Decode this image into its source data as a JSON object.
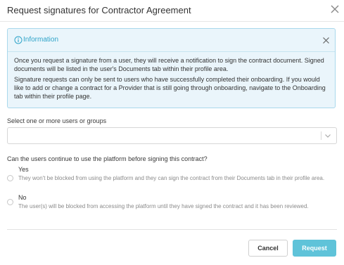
{
  "dialog": {
    "title": "Request signatures for Contractor Agreement",
    "close_icon": "close-icon"
  },
  "info": {
    "icon": "info-circle-icon",
    "title": "Information",
    "close_icon": "close-icon",
    "paragraph1": "Once you request a signature from a user, they will receive a notification to sign the contract document. Signed documents will be listed in the user's Documents tab within their profile area.",
    "paragraph2": "Signature requests can only be sent to users who have successfully completed their onboarding. If you would like to add or change a contract for a Provider that is still going through onboarding, navigate to the Onboarding tab within their profile page.",
    "accent_color": "#2fa4c9",
    "background_color": "#eaf5fb"
  },
  "select": {
    "label": "Select one or more users or groups",
    "value": "",
    "chevron_icon": "chevron-down-icon"
  },
  "question": {
    "label": "Can the users continue to use the platform before signing this contract?",
    "options": [
      {
        "label": "Yes",
        "description": "They won't be blocked from using the platform and they can sign the contract from their Documents tab in their profile area."
      },
      {
        "label": "No",
        "description": "The user(s) will be blocked from accessing the platform until they have signed the contract and it has been reviewed."
      }
    ]
  },
  "footer": {
    "cancel_label": "Cancel",
    "request_label": "Request",
    "primary_color": "#5fc3d9"
  }
}
